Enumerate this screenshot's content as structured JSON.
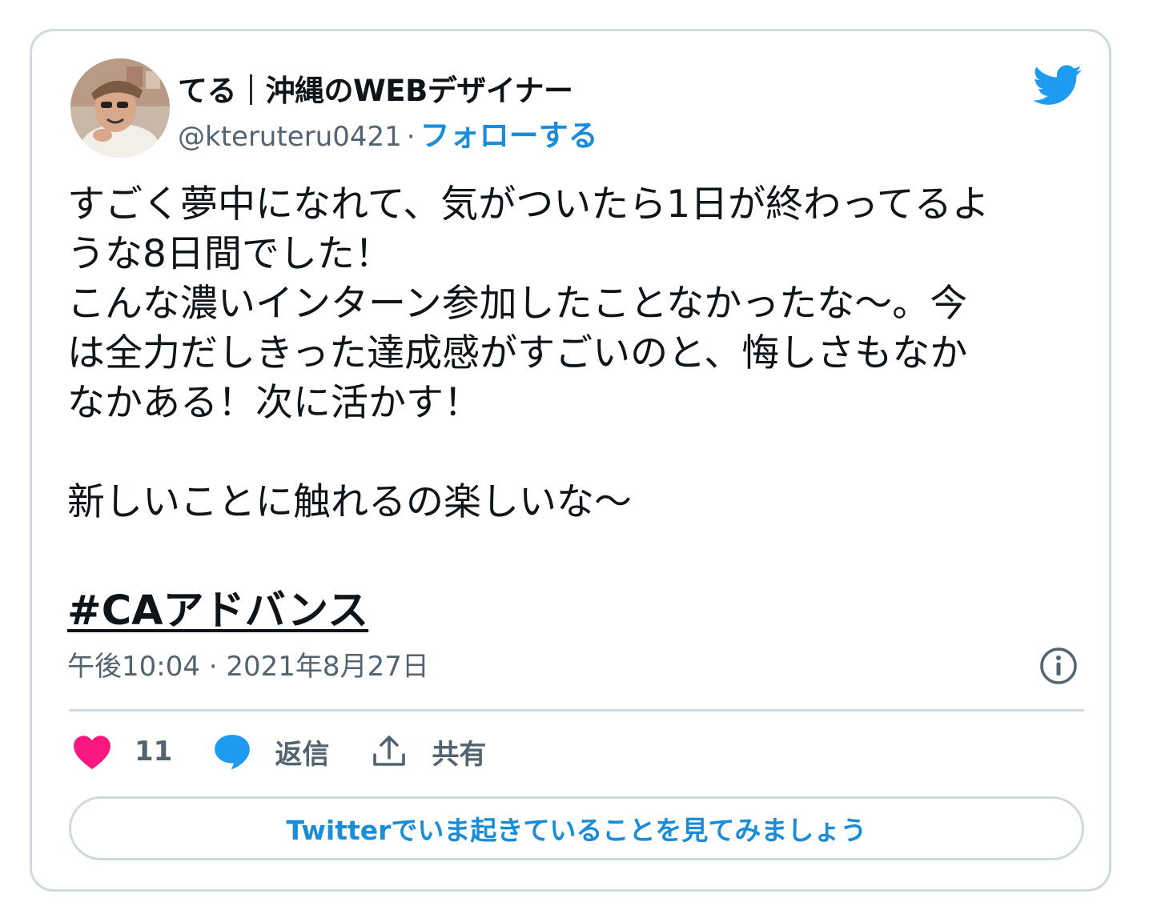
{
  "author": {
    "display_name": "てる｜沖縄のWEBデザイナー",
    "handle": "@kteruteru0421",
    "separator": "·",
    "follow_label": "フォローする"
  },
  "tweet": {
    "text": "すごく夢中になれて、気がついたら1日が終わってるよ\nうな8日間でした！\nこんな濃いインターン参加したことなかったな〜。今\nは全力だしきった達成感がすごいのと、悔しさもなか\nなかある！次に活かす！\n\n新しいことに触れるの楽しいな〜",
    "hashtag": "#CAアドバンス",
    "timestamp": "午後10:04 · 2021年8月27日"
  },
  "actions": {
    "like_count": "11",
    "reply_label": "返信",
    "share_label": "共有"
  },
  "cta_label": "Twitterでいま起きていることを見てみましょう",
  "icons": {
    "brand": "twitter-bird-icon",
    "info": "info-icon",
    "like": "heart-icon",
    "reply": "speech-bubble-icon",
    "share": "share-upload-icon"
  },
  "colors": {
    "accent": "#1a8cd8",
    "twitter_blue": "#1d9bf0",
    "like": "#f91880",
    "text": "#0f1419",
    "muted": "#536471",
    "border": "#cfd9de"
  }
}
